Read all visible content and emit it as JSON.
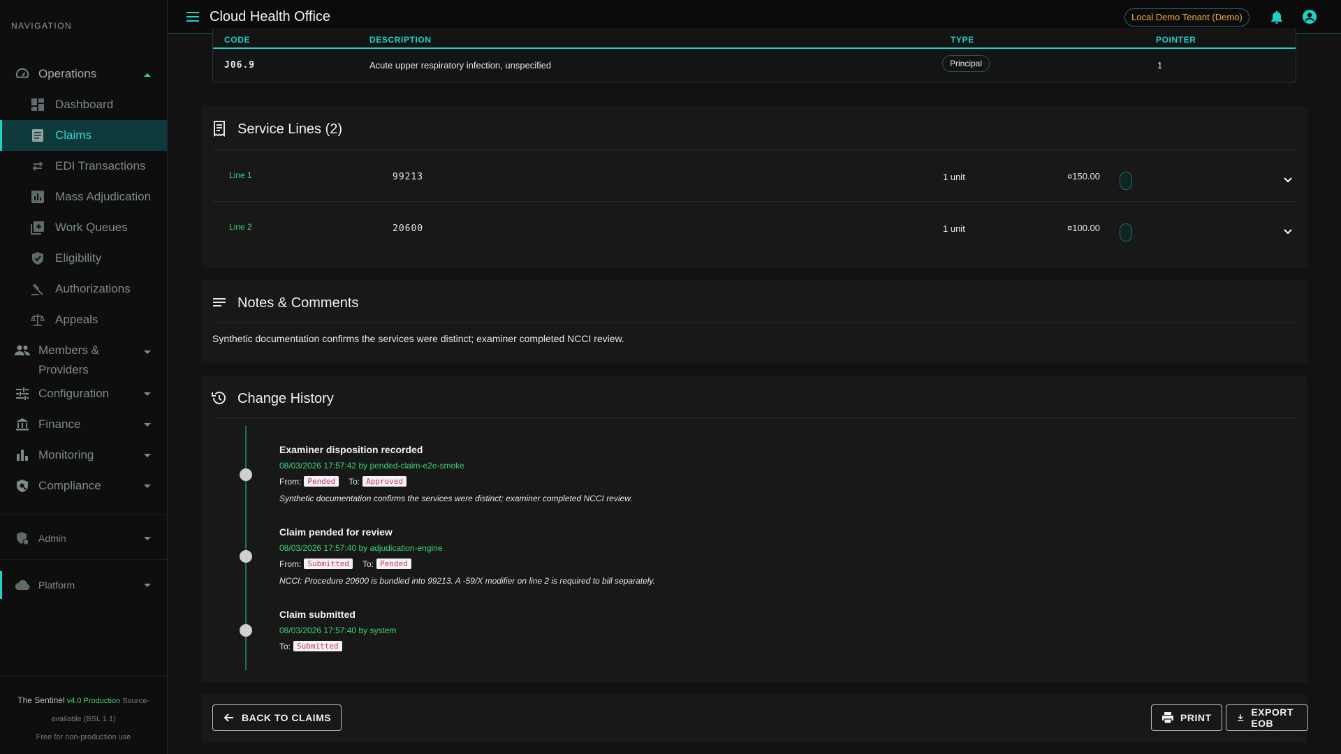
{
  "sidebar": {
    "heading": "NAVIGATION",
    "items": [
      {
        "label": "Operations",
        "icon": "speedometer-icon"
      },
      {
        "label": "Dashboard",
        "icon": "dashboard-icon"
      },
      {
        "label": "Claims",
        "icon": "claims-icon"
      },
      {
        "label": "EDI Transactions",
        "icon": "swap-arrows-icon"
      },
      {
        "label": "Mass Adjudication",
        "icon": "bar-chart-box-icon"
      },
      {
        "label": "Work Queues",
        "icon": "queue-add-icon"
      },
      {
        "label": "Eligibility",
        "icon": "verified-shield-icon"
      },
      {
        "label": "Authorizations",
        "icon": "gavel-icon"
      },
      {
        "label": "Appeals",
        "icon": "scale-icon"
      },
      {
        "label": "Members & Providers",
        "icon": "people-icon"
      },
      {
        "label": "Configuration",
        "icon": "tune-icon"
      },
      {
        "label": "Finance",
        "icon": "bank-icon"
      },
      {
        "label": "Monitoring",
        "icon": "bar-chart-icon"
      },
      {
        "label": "Compliance",
        "icon": "policy-shield-icon"
      },
      {
        "label": "Admin",
        "icon": "admin-shield-icon"
      },
      {
        "label": "Platform",
        "icon": "cloud-icon"
      }
    ],
    "footer": {
      "brand": "The Sentinel",
      "version": "v4.0 Production",
      "license_part1": "Source-",
      "license_part2": "available (BSL 1.1)",
      "note": "Free for non-production use"
    }
  },
  "topbar": {
    "title": "Cloud Health Office",
    "tenant": "Local Demo Tenant (Demo)"
  },
  "diagnosis": {
    "headers": {
      "code": "CODE",
      "description": "DESCRIPTION",
      "type": "TYPE",
      "pointer": "POINTER"
    },
    "rows": [
      {
        "code": "J06.9",
        "description": "Acute upper respiratory infection, unspecified",
        "type": "Principal",
        "pointer": "1"
      }
    ]
  },
  "service_lines": {
    "title": "Service Lines (2)",
    "lines": [
      {
        "label": "Line 1",
        "code": "99213",
        "units": "1 unit",
        "amount": "¤150.00"
      },
      {
        "label": "Line 2",
        "code": "20600",
        "units": "1 unit",
        "amount": "¤100.00"
      }
    ]
  },
  "notes": {
    "title": "Notes & Comments",
    "text": "Synthetic documentation confirms the services were distinct; examiner completed NCCI review."
  },
  "history": {
    "title": "Change History",
    "from_label": "From:",
    "to_label": "To:",
    "entries": [
      {
        "title": "Examiner disposition recorded",
        "meta": "08/03/2026 17:57:42 by pended-claim-e2e-smoke",
        "from": "Pended",
        "to": "Approved",
        "note": "Synthetic documentation confirms the services were distinct; examiner completed NCCI review."
      },
      {
        "title": "Claim pended for review",
        "meta": "08/03/2026 17:57:40 by adjudication-engine",
        "from": "Submitted",
        "to": "Pended",
        "note": "NCCI: Procedure 20600 is bundled into 99213. A -59/X modifier on line 2 is required to bill separately."
      },
      {
        "title": "Claim submitted",
        "meta": "08/03/2026 17:57:40 by system",
        "to": "Submitted"
      }
    ]
  },
  "actions": {
    "back": "BACK TO CLAIMS",
    "print": "PRINT",
    "export": "EXPORT EOB"
  },
  "colors": {
    "accent": "#1fd1c3",
    "success_text": "#39d27a",
    "tenant_text": "#f0b03a",
    "tag_text": "#d3346a",
    "background": "#121212",
    "card": "#181818"
  }
}
